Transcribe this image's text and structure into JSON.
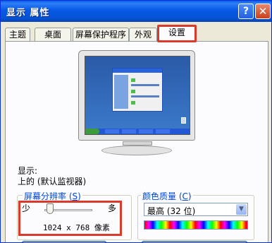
{
  "window": {
    "title": "显示 属性",
    "help_label": "?",
    "close_label": "✕"
  },
  "tabs": [
    {
      "label": "主题"
    },
    {
      "label": "桌面"
    },
    {
      "label": "屏幕保护程序"
    },
    {
      "label": "外观"
    },
    {
      "label": "设置",
      "active": true
    }
  ],
  "display": {
    "label": "显示:",
    "device": "上的 (默认监视器)"
  },
  "resolution": {
    "legend": "屏幕分辨率",
    "legend_key": "S",
    "min_label": "少",
    "max_label": "多",
    "value_text": "1024 x 768 像素",
    "slider_level_fraction": 0.1
  },
  "color_quality": {
    "legend": "颜色质量",
    "legend_key": "C",
    "selected": "最高 (32 位)"
  },
  "colors": {
    "titlebar": "#0758e6",
    "highlight_border": "#d93a2c",
    "legend_text": "#0046d5",
    "desktop": "#3a6ea5"
  },
  "icons": [
    "help-icon",
    "close-icon",
    "monitor-preview",
    "chevron-down-icon"
  ]
}
